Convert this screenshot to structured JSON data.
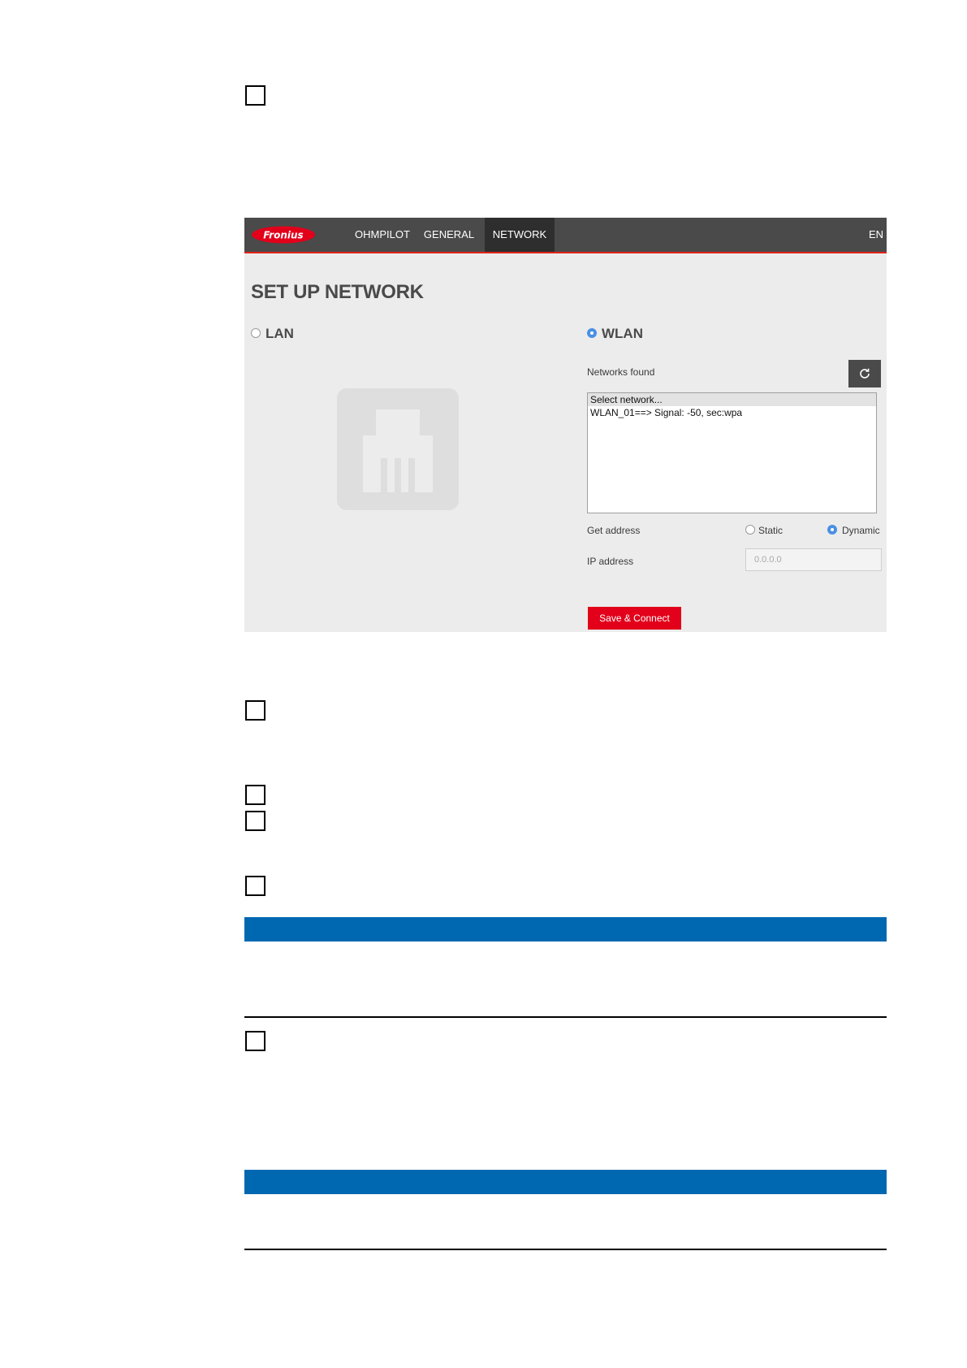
{
  "app": {
    "brand": "Fronius",
    "nav": [
      {
        "label": "OHMPILOT"
      },
      {
        "label": "GENERAL"
      },
      {
        "label": "NETWORK",
        "active": true
      }
    ],
    "language": "EN"
  },
  "page": {
    "title": "SET UP NETWORK"
  },
  "lan": {
    "label": "LAN",
    "selected": false,
    "icon": "ethernet-port-icon"
  },
  "wlan": {
    "label": "WLAN",
    "selected": true,
    "networks_found_label": "Networks found",
    "refresh_icon": "refresh-icon",
    "networks": [
      {
        "text": "Select network...",
        "selected": true
      },
      {
        "text": "WLAN_01==> Signal: -50, sec:wpa",
        "selected": false
      }
    ],
    "get_address_label": "Get address",
    "static_label": "Static",
    "static_selected": false,
    "dynamic_label": "Dynamic",
    "dynamic_selected": true,
    "ip_label": "IP address",
    "ip_placeholder": "0.0.0.0",
    "save_label": "Save & Connect"
  },
  "colors": {
    "accent_red": "#e2001a",
    "topbar": "#4a4a4a",
    "info_blue": "#0067b1",
    "radio_blue": "#4a90e2"
  }
}
